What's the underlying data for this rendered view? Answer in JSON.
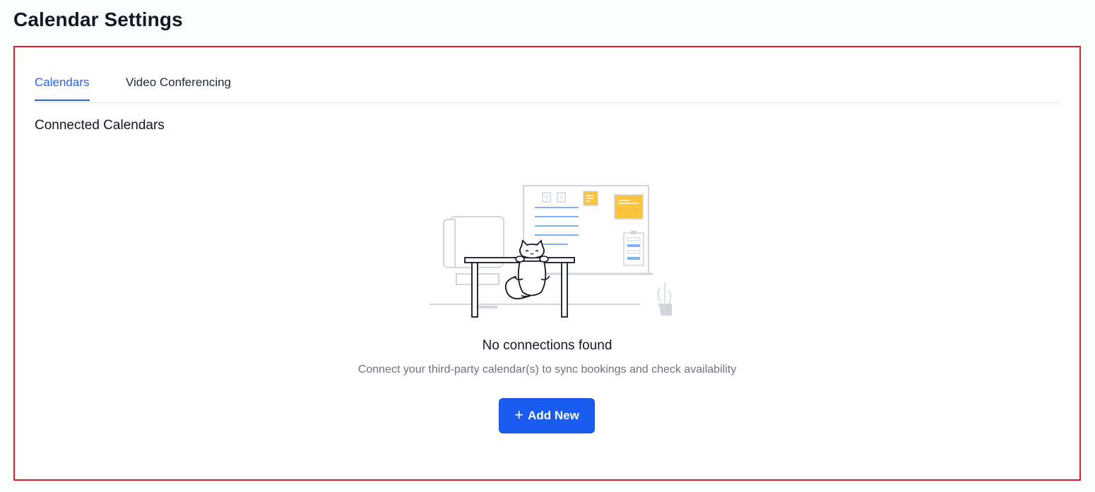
{
  "page": {
    "title": "Calendar Settings"
  },
  "tabs": [
    {
      "label": "Calendars",
      "active": true
    },
    {
      "label": "Video Conferencing",
      "active": false
    }
  ],
  "section": {
    "title": "Connected Calendars"
  },
  "empty_state": {
    "illustration": "cat-on-desk-illustration",
    "title": "No connections found",
    "description": "Connect your third-party calendar(s) to sync bookings and check availability"
  },
  "actions": {
    "add_new_label": "Add New",
    "add_new_icon": "plus-icon"
  },
  "colors": {
    "accent": "#2563eb",
    "button": "#1a5cf0",
    "highlight_border": "#e11d23",
    "note_yellow": "#fcc43d",
    "line_blue": "#7fb3f5"
  }
}
